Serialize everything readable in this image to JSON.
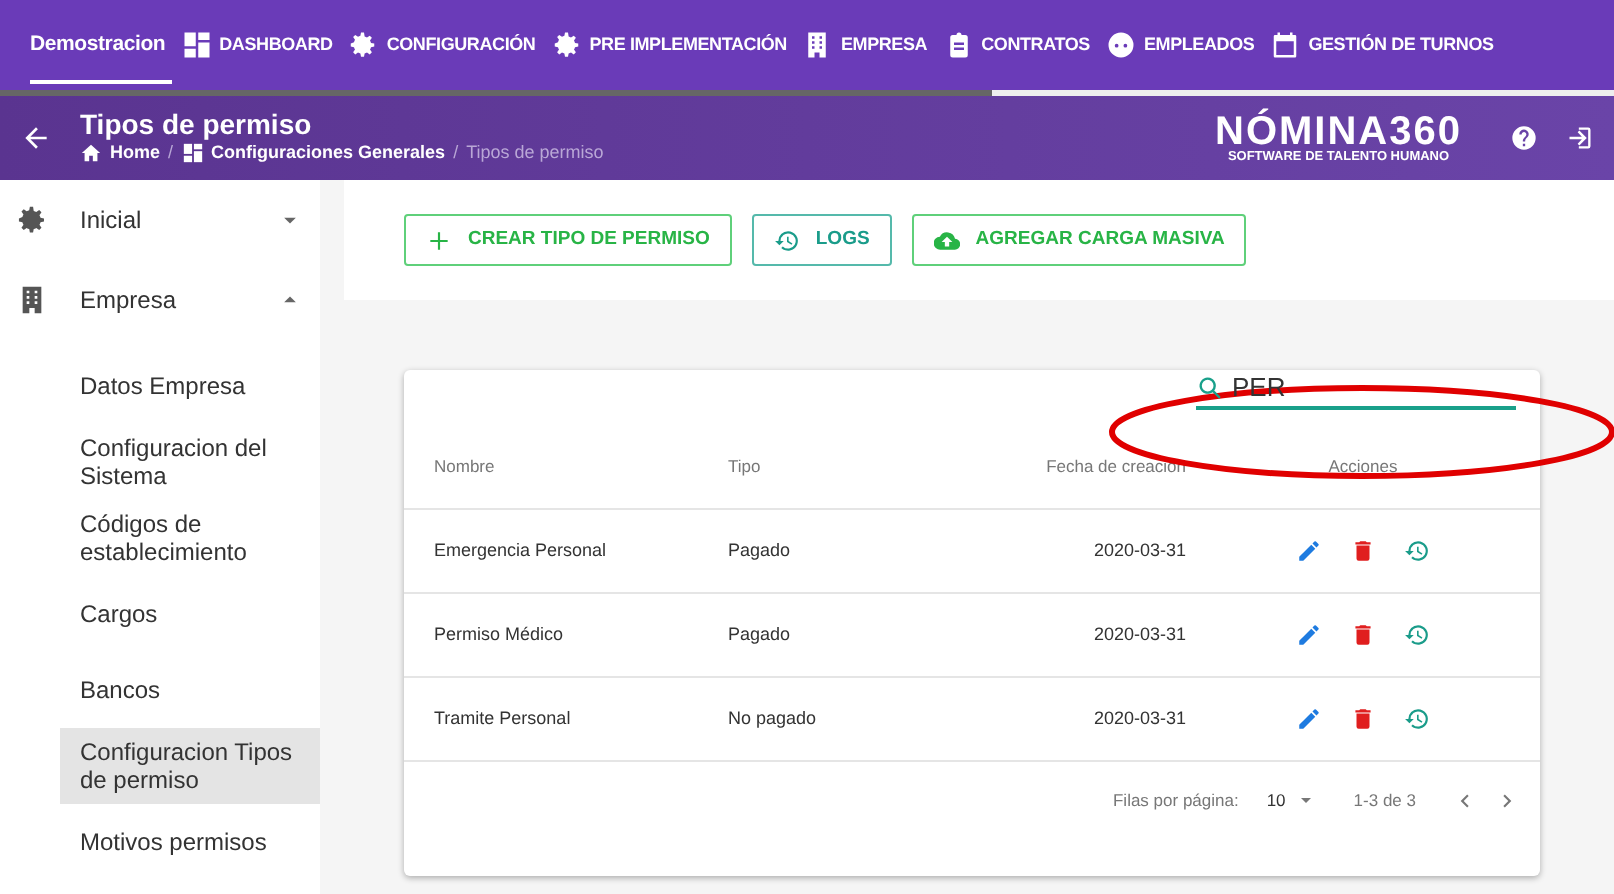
{
  "top_nav": {
    "items": [
      {
        "label": "Demostracion",
        "kind": "plain",
        "selected": true
      },
      {
        "label": "DASHBOARD",
        "kind": "grid",
        "selected": false
      },
      {
        "label": "CONFIGURACIÓN",
        "kind": "gear",
        "selected": false
      },
      {
        "label": "PRE IMPLEMENTACIÓN",
        "kind": "gear",
        "selected": false
      },
      {
        "label": "EMPRESA",
        "kind": "building",
        "selected": false
      },
      {
        "label": "CONTRATOS",
        "kind": "clipboard",
        "selected": false
      },
      {
        "label": "EMPLEADOS",
        "kind": "face",
        "selected": false
      },
      {
        "label": "GESTIÓN DE TURNOS",
        "kind": "calendar",
        "selected": false
      }
    ],
    "progress": {
      "level": 0.615
    }
  },
  "header": {
    "title": "Tipos de permiso",
    "breadcrumb": [
      {
        "label": "Home",
        "kind": "home"
      },
      {
        "label": "/",
        "kind": "separator"
      },
      {
        "label": "Configuraciones Generales",
        "kind": "grid"
      },
      {
        "label": "/",
        "kind": "separator"
      },
      {
        "label": "Tipos de permiso",
        "kind": "current"
      }
    ],
    "logo": {
      "wordmark": "NÓMINA360",
      "tagline": "SOFTWARE DE TALENTO HUMANO"
    }
  },
  "sidebar": {
    "items": [
      {
        "label": "Inicial",
        "kind": "gear",
        "expanded": false
      },
      {
        "label": "Empresa",
        "kind": "building",
        "expanded": true,
        "children": [
          {
            "label": "Datos Empresa",
            "selected": false
          },
          {
            "label": "Configuracion del Sistema",
            "selected": false
          },
          {
            "label": "Códigos de establecimiento",
            "selected": false
          },
          {
            "label": "Cargos",
            "selected": false
          },
          {
            "label": "Bancos",
            "selected": false
          },
          {
            "label": "Configuracion Tipos de permiso",
            "selected": true
          },
          {
            "label": "Motivos permisos",
            "selected": false
          }
        ]
      }
    ]
  },
  "toolbar": {
    "buttons": [
      {
        "label": "CREAR TIPO DE PERMISO",
        "kind": "create"
      },
      {
        "label": "LOGS",
        "kind": "logs"
      },
      {
        "label": "AGREGAR CARGA MASIVA",
        "kind": "upload"
      }
    ]
  },
  "table": {
    "search": {
      "value": "PER"
    },
    "columns": [
      "Nombre",
      "Tipo",
      "Fecha de creación",
      "Acciones"
    ],
    "rows": [
      {
        "nombre": "Emergencia Personal",
        "tipo": "Pagado",
        "fecha": "2020-03-31"
      },
      {
        "nombre": "Permiso Médico",
        "tipo": "Pagado",
        "fecha": "2020-03-31"
      },
      {
        "nombre": "Tramite Personal",
        "tipo": "No pagado",
        "fecha": "2020-03-31"
      }
    ],
    "pagination": {
      "rows_label": "Filas por página:",
      "rows_per_page": "10",
      "range": "1-3 de 3"
    }
  },
  "annotation": {
    "kind": "ellipse"
  }
}
